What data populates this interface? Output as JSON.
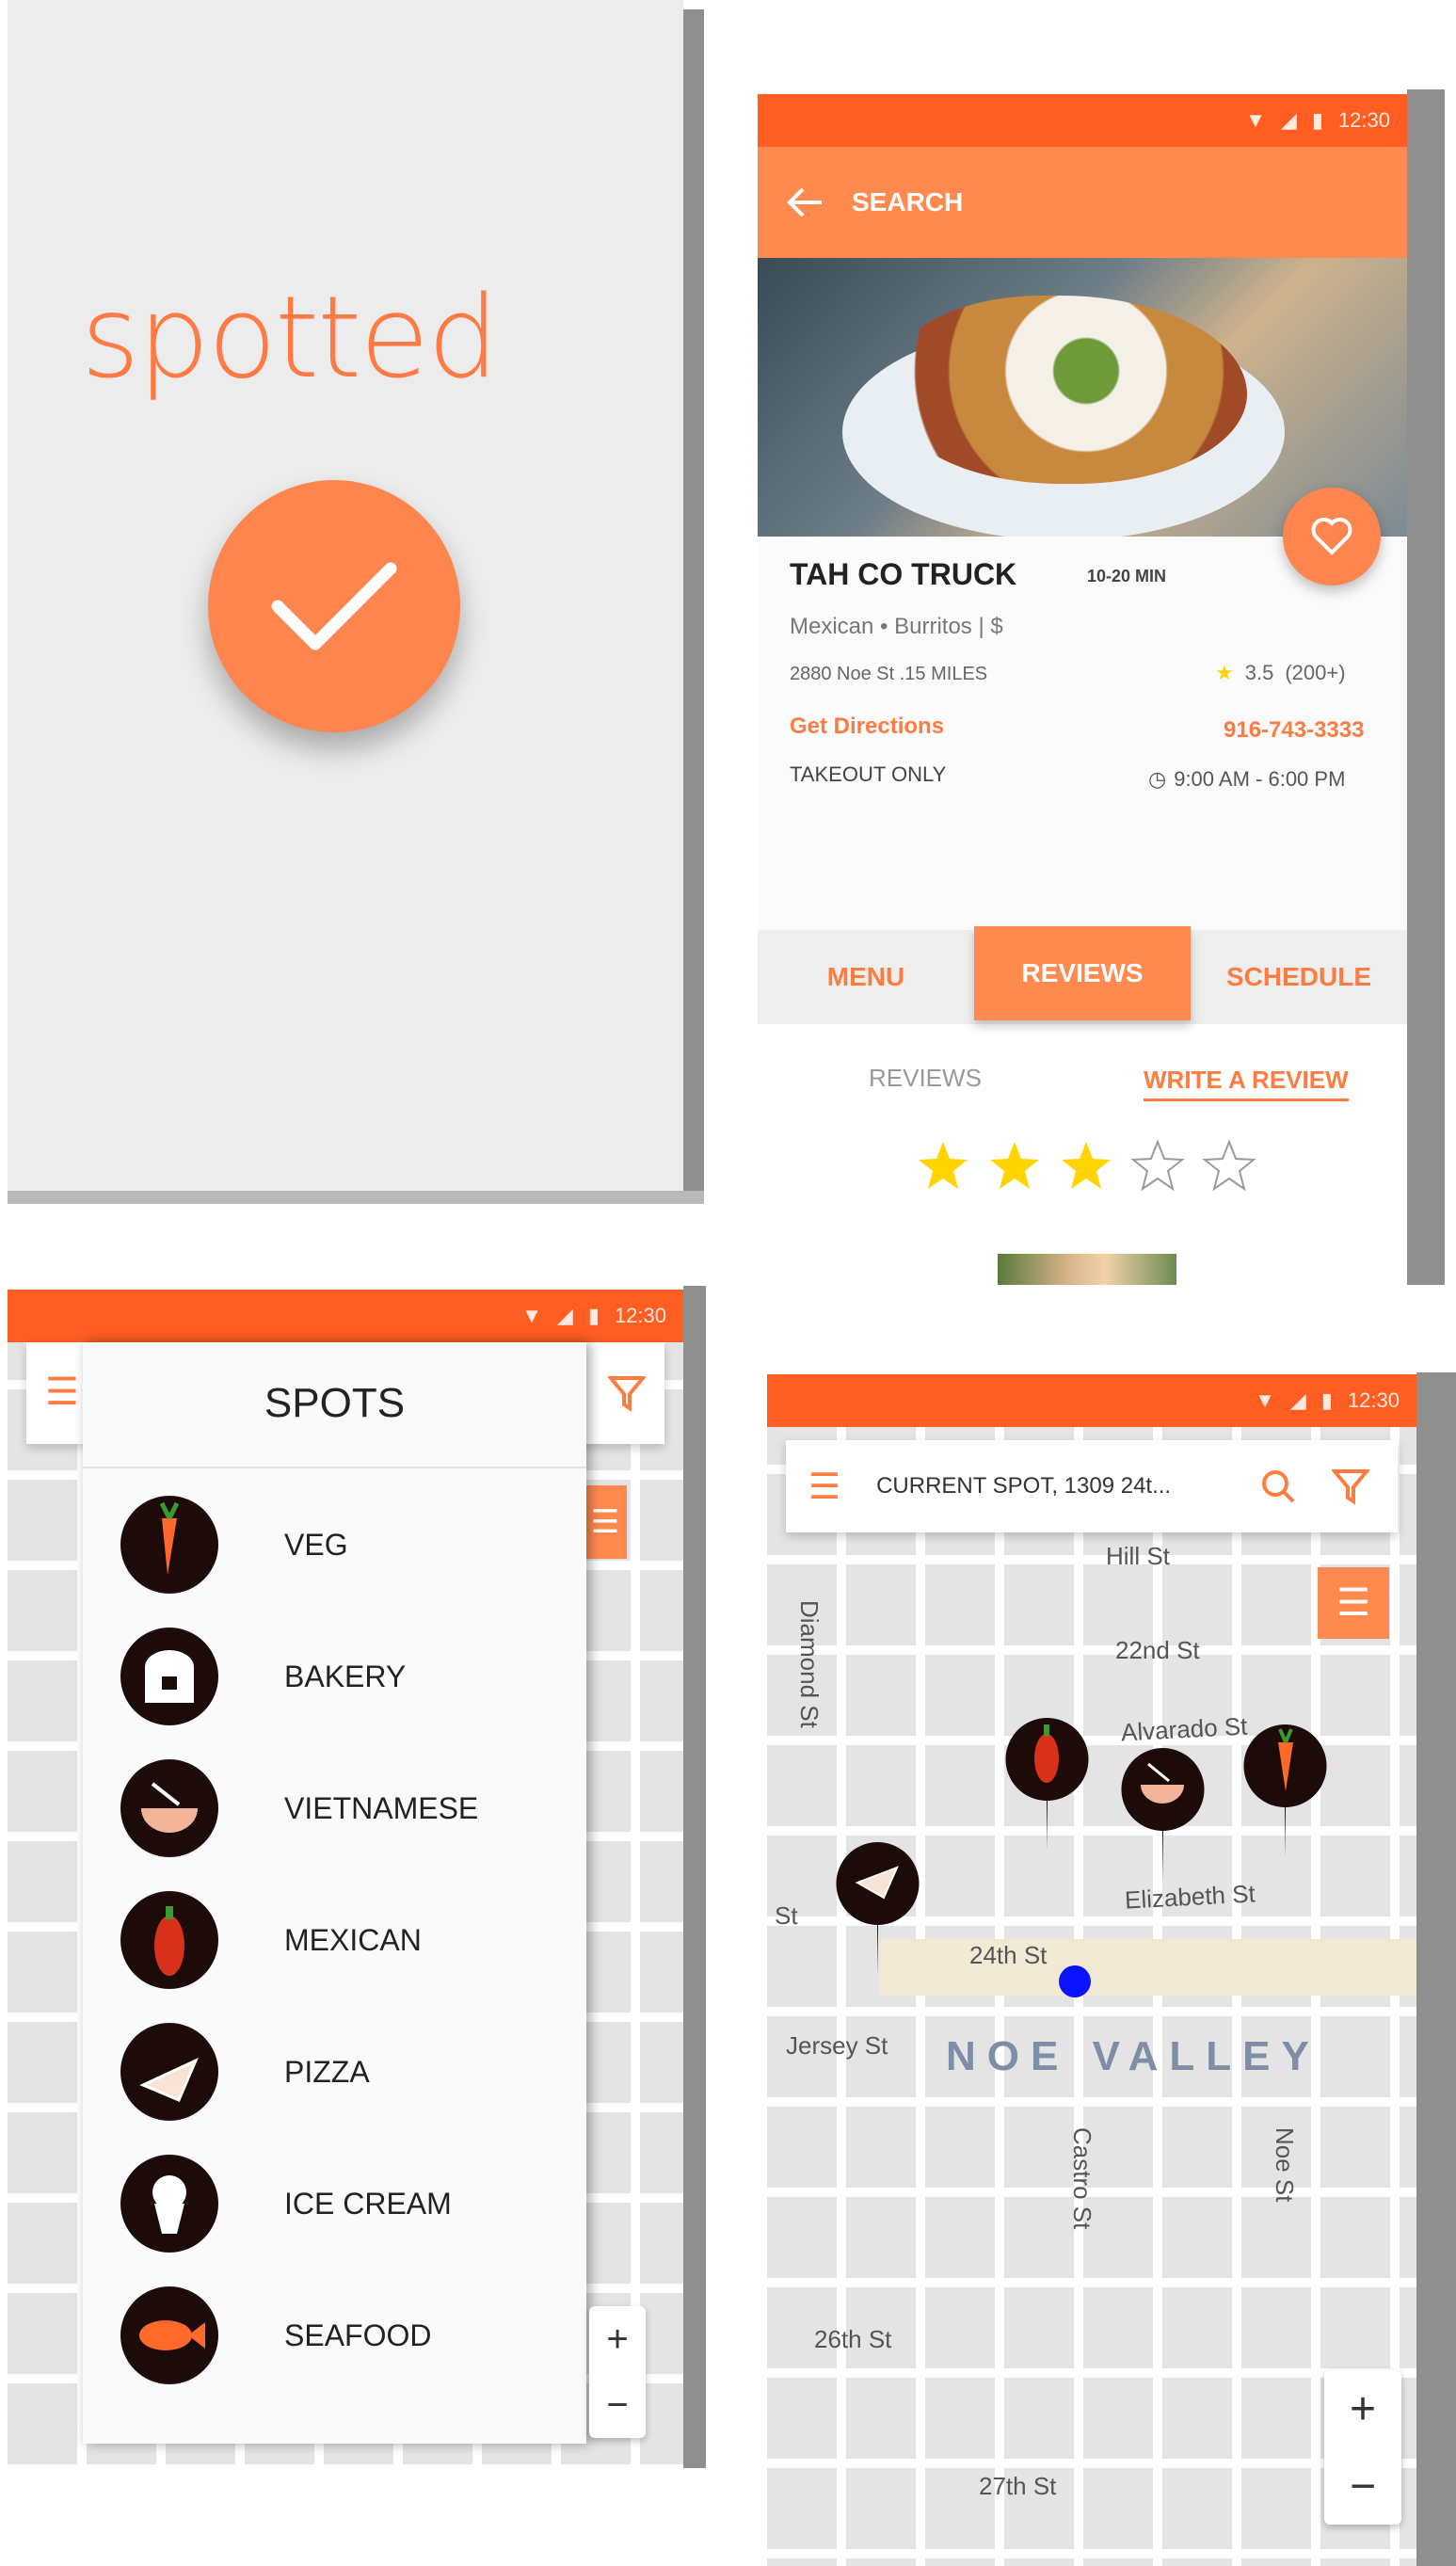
{
  "status_bar": {
    "time": "12:30"
  },
  "splash": {
    "logo_text": "spotted"
  },
  "detail": {
    "back_label": "SEARCH",
    "truck_name": "TAH CO TRUCK",
    "wait_time": "10-20 MIN",
    "cuisine": "Mexican • Burritos  |  $",
    "address": "2880 Noe St .15 MILES",
    "rating": "3.5",
    "rating_count": "(200+)",
    "directions_link": "Get Directions",
    "phone": "916-743-3333",
    "service": "TAKEOUT ONLY",
    "hours": "9:00 AM - 6:00 PM",
    "tabs": [
      "MENU",
      "REVIEWS",
      "SCHEDULE"
    ],
    "reviews_label": "REVIEWS",
    "write_review_link": "WRITE A REVIEW",
    "star_rating": 3,
    "star_max": 5,
    "colors": {
      "accent": "#ff8a4f",
      "star": "#ffd400"
    }
  },
  "spots": {
    "title": "SPOTS",
    "items": [
      {
        "label": "VEG",
        "icon": "carrot-icon"
      },
      {
        "label": "BAKERY",
        "icon": "bread-icon"
      },
      {
        "label": "VIETNAMESE",
        "icon": "noodle-bowl-icon"
      },
      {
        "label": "MEXICAN",
        "icon": "chili-pepper-icon"
      },
      {
        "label": "PIZZA",
        "icon": "pizza-slice-icon"
      },
      {
        "label": "ICE CREAM",
        "icon": "ice-cream-icon"
      },
      {
        "label": "SEAFOOD",
        "icon": "fish-icon"
      }
    ]
  },
  "map": {
    "search_text": "CURRENT SPOT, 1309 24t...",
    "neighborhood": "NOE VALLEY",
    "streets": [
      "Hill St",
      "22nd St",
      "Alvarado St",
      "Elizabeth St",
      "24th St",
      "Jersey St",
      "26th St",
      "27th St",
      "Diamond St",
      "Castro St",
      "Noe St",
      "St"
    ],
    "zoom_in": "+",
    "zoom_out": "−"
  }
}
